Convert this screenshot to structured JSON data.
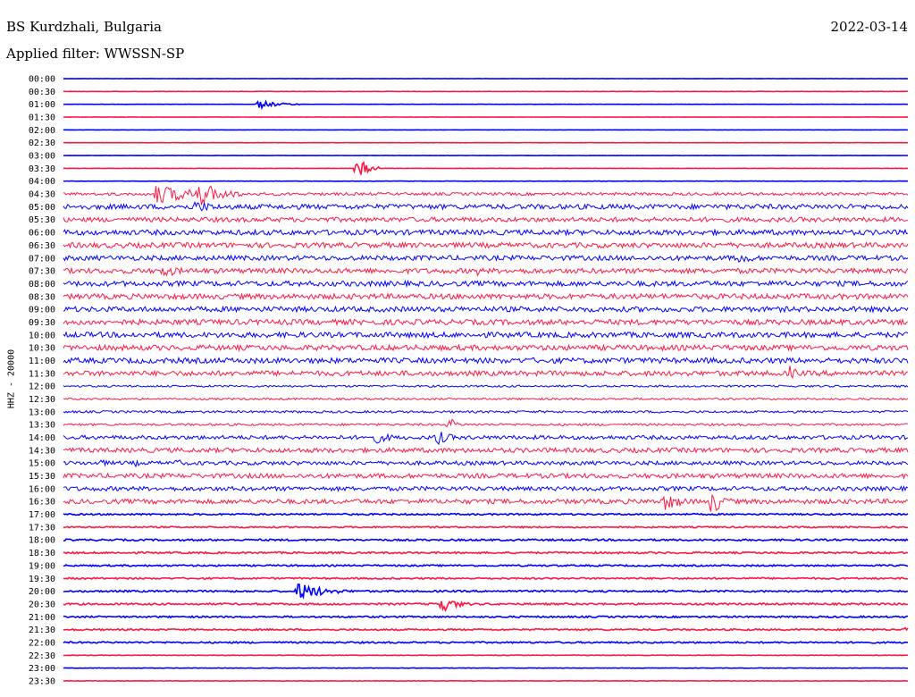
{
  "header": {
    "station": "BS Kurdzhali, Bulgaria",
    "date": "2022-03-14",
    "filter": "Applied filter: WWSSN-SP"
  },
  "chart_data": {
    "type": "line",
    "title": "BS Kurdzhali, Bulgaria",
    "subtitle": "Applied filter: WWSSN-SP",
    "date": "2022-03-14",
    "ylabel": "HHZ - 20000",
    "row_labels": [
      "00:00",
      "00:30",
      "01:00",
      "01:30",
      "02:00",
      "02:30",
      "03:00",
      "03:30",
      "04:00",
      "04:30",
      "05:00",
      "05:30",
      "06:00",
      "06:30",
      "07:00",
      "07:30",
      "08:00",
      "08:30",
      "09:00",
      "09:30",
      "10:00",
      "10:30",
      "11:00",
      "11:30",
      "12:00",
      "12:30",
      "13:00",
      "13:30",
      "14:00",
      "14:30",
      "15:00",
      "15:30",
      "16:00",
      "16:30",
      "17:00",
      "17:30",
      "18:00",
      "18:30",
      "19:00",
      "19:30",
      "20:00",
      "20:30",
      "21:00",
      "21:30",
      "22:00",
      "22:30",
      "23:00",
      "23:30"
    ],
    "x_range_minutes": [
      0,
      30
    ],
    "series_colors": [
      "#0000ff",
      "#ff1744"
    ],
    "noise_level": [
      0.1,
      0.15,
      0.1,
      0.1,
      0.1,
      0.1,
      0.1,
      0.15,
      0.2,
      1.6,
      2.8,
      2.6,
      2.9,
      2.9,
      2.7,
      2.8,
      2.9,
      3.0,
      2.9,
      3.0,
      3.0,
      3.0,
      3.0,
      2.8,
      1.1,
      1.1,
      1.3,
      1.3,
      2.2,
      2.6,
      2.2,
      2.6,
      2.4,
      2.6,
      0.9,
      0.8,
      1.0,
      1.0,
      0.9,
      0.9,
      1.0,
      1.0,
      0.9,
      0.9,
      0.9,
      0.3,
      0.25,
      0.25
    ],
    "events": [
      {
        "row": 2,
        "minute": 6.9,
        "amplitude": 5,
        "duration_min": 1.5
      },
      {
        "row": 7,
        "minute": 10.4,
        "amplitude": 14,
        "duration_min": 0.8
      },
      {
        "row": 9,
        "minute": 3.2,
        "amplitude": 12,
        "duration_min": 3.5
      },
      {
        "row": 9,
        "minute": 4.7,
        "amplitude": 16,
        "duration_min": 2.0
      },
      {
        "row": 10,
        "minute": 4.6,
        "amplitude": 8,
        "duration_min": 2.0
      },
      {
        "row": 14,
        "minute": 24.0,
        "amplitude": 7,
        "duration_min": 1.5
      },
      {
        "row": 15,
        "minute": 3.4,
        "amplitude": 8,
        "duration_min": 2.0
      },
      {
        "row": 15,
        "minute": 14.7,
        "amplitude": 6,
        "duration_min": 0.5
      },
      {
        "row": 15,
        "minute": 16.5,
        "amplitude": 6,
        "duration_min": 0.5
      },
      {
        "row": 23,
        "minute": 25.8,
        "amplitude": 9,
        "duration_min": 0.8
      },
      {
        "row": 27,
        "minute": 13.7,
        "amplitude": 9,
        "duration_min": 0.6
      },
      {
        "row": 28,
        "minute": 11.0,
        "amplitude": 8,
        "duration_min": 1.5
      },
      {
        "row": 28,
        "minute": 13.2,
        "amplitude": 10,
        "duration_min": 1.2
      },
      {
        "row": 30,
        "minute": 1.3,
        "amplitude": 5,
        "duration_min": 0.8
      },
      {
        "row": 30,
        "minute": 2.5,
        "amplitude": 5,
        "duration_min": 0.6
      },
      {
        "row": 30,
        "minute": 4.0,
        "amplitude": 6,
        "duration_min": 0.6
      },
      {
        "row": 33,
        "minute": 21.3,
        "amplitude": 11,
        "duration_min": 1.6
      },
      {
        "row": 33,
        "minute": 23.0,
        "amplitude": 16,
        "duration_min": 1.0
      },
      {
        "row": 40,
        "minute": 8.3,
        "amplitude": 11,
        "duration_min": 2.0
      },
      {
        "row": 41,
        "minute": 13.3,
        "amplitude": 12,
        "duration_min": 1.2
      },
      {
        "row": 43,
        "minute": 30.0,
        "amplitude": 11,
        "duration_min": 1.2
      }
    ]
  }
}
